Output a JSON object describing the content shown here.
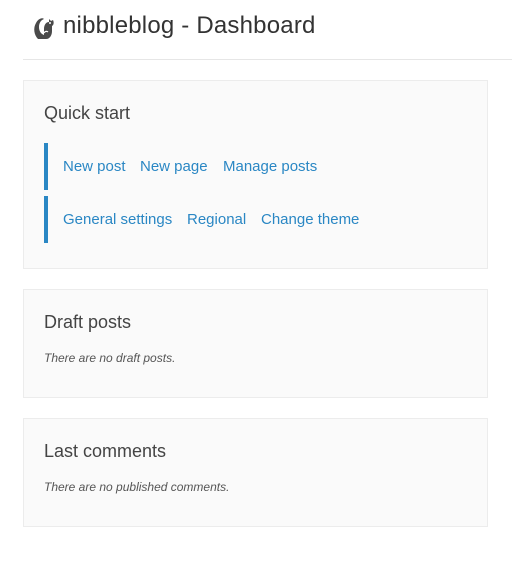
{
  "header": {
    "logo_icon": "squirrel-logo-icon",
    "title": "nibbleblog - Dashboard"
  },
  "quick_start": {
    "title": "Quick start",
    "row1": [
      "New post",
      "New page",
      "Manage posts"
    ],
    "row2": [
      "General settings",
      "Regional",
      "Change theme"
    ]
  },
  "draft_posts": {
    "title": "Draft posts",
    "empty_text": "There are no draft posts."
  },
  "last_comments": {
    "title": "Last comments",
    "empty_text": "There are no published comments."
  },
  "colors": {
    "accent": "#2a87c4",
    "panel_bg": "#fafafa",
    "panel_border": "#ececec"
  }
}
